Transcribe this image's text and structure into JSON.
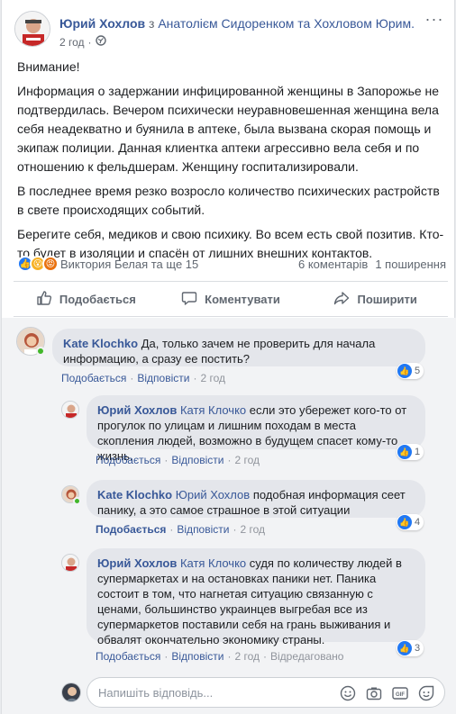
{
  "post": {
    "author": "Юрий Хохлов",
    "with_text": "з",
    "tagged": "Анатолієм Сидоренком та Хохловом Юрим.",
    "time": "2 год",
    "paragraphs": [
      "Внимание!",
      "Информация о задержании инфицированной женщины в Запорожье не подтвердилась. Вечером психически неуравновешенная женщина вела себя неадекватно и буянила в аптеке, была вызвана скорая помощь и экипаж полиции. Данная клиентка аптеки агрессивно вела себя и по отношению к фельдшерам. Женщину госпитализировали.",
      "В последнее время резко возросло количество психических растройств в свете происходящих событий.",
      "Берегите себя, медиков и свою психику. Во всем есть свой позитив. Кто-то будет в изоляции и спасён от лишних внешних контактов."
    ],
    "reactions_text": "Виктория Белая та ще 15",
    "comments_count": "6 коментарів",
    "shares_count": "1 поширення"
  },
  "actions": {
    "like": "Подобається",
    "comment": "Коментувати",
    "share": "Поширити"
  },
  "comments": [
    {
      "author": "Kate Klochko",
      "text": "Да, только зачем не проверить для начала информацию, а сразу ее постить?",
      "like_label": "Подобається",
      "reply_label": "Відповісти",
      "time": "2 год",
      "likes": "5"
    },
    {
      "author": "Юрий Хохлов",
      "mention": "Катя Клочко",
      "text": "если это убережет кого-то от прогулок по улицам и лишним походам в места скопления людей, возможно в будущем спасет кому-то жизнь.",
      "like_label": "Подобається",
      "reply_label": "Відповісти",
      "time": "2 год",
      "likes": "1"
    },
    {
      "author": "Kate Klochko",
      "mention": "Юрий Хохлов",
      "text": "подобная информация сеет панику, а это самое страшное в этой ситуации",
      "like_label": "Подобається",
      "reply_label": "Відповісти",
      "time": "2 год",
      "likes": "4"
    },
    {
      "author": "Юрий Хохлов",
      "mention": "Катя Клочко",
      "text": "судя по количеству людей в супермаркетах и на остановках паники нет. Паника состоит в том, что нагнетая ситуацию связанную с ценами, большинство украинцев выгребая все из супермаркетов поставили себя на грань выживания и обвалят окончательно экономику страны.",
      "like_label": "Подобається",
      "reply_label": "Відповісти",
      "time": "2 год",
      "edited": "Відредаговано",
      "likes": "3"
    }
  ],
  "reply": {
    "placeholder": "Напишіть відповідь..."
  },
  "colors": {
    "link": "#385898",
    "like_blue": "#2078f4",
    "bubble": "#e4e6eb",
    "online": "#42b72a"
  }
}
